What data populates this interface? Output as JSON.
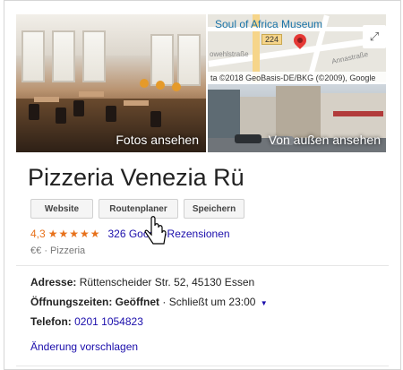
{
  "media": {
    "photo_caption": "Fotos ansehen",
    "map": {
      "poi_label": "Soul of Africa Museum",
      "road_badge": "224",
      "street_label_1": "Annastraße",
      "street_label_2": "owehlstraße",
      "attribution": "ta ©2018 GeoBasis-DE/BKG (©2009), Google",
      "expand_glyph": "⤢"
    },
    "streetview_caption": "Von außen ansehen"
  },
  "business": {
    "name": "Pizzeria Venezia Rü",
    "actions": {
      "website": "Website",
      "route": "Routenplaner",
      "save": "Speichern"
    },
    "rating": "4,3",
    "stars": "★★★★★",
    "review_count": "326 Google-Rezensionen",
    "price": "€€",
    "category": "Pizzeria",
    "meta_sep": "·"
  },
  "details": {
    "address_label": "Adresse:",
    "address_value": "Rüttenscheider Str. 52, 45130 Essen",
    "hours_label": "Öffnungszeiten:",
    "hours_status": "Geöffnet",
    "hours_sep": "·",
    "hours_detail": "Schließt um 23:00",
    "hours_caret": "▼",
    "phone_label": "Telefon:",
    "phone_value": "0201 1054823",
    "suggest_edit": "Änderung vorschlagen"
  },
  "colors": {
    "link": "#1a0dab",
    "rating": "#e7711b",
    "pin": "#e53935"
  }
}
